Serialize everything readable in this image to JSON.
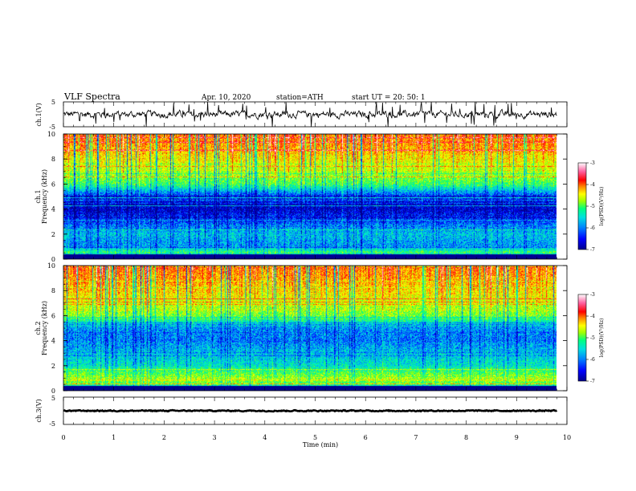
{
  "header": {
    "title": "VLF  Spectra",
    "date": "Apr. 10, 2020",
    "station": "station=ATH",
    "start": "start  UT  =    20: 50: 1"
  },
  "colors": {
    "background": "#ffffff",
    "axes": "#000000",
    "waveform": "#000000",
    "colormap": [
      "#00008b",
      "#0000ff",
      "#0080ff",
      "#00e0e0",
      "#00ff80",
      "#a0ff00",
      "#ffff00",
      "#ff8000",
      "#ff0000",
      "#ff60a0",
      "#ffffff"
    ]
  },
  "chart_data": [
    {
      "type": "line",
      "panel": "ch1-waveform",
      "ylabel": "ch.1(V)",
      "ylim": [
        -5,
        5
      ],
      "y_tick_labels": [
        "5",
        "-5"
      ],
      "x_range_min": [
        0,
        9.8
      ],
      "trace_level_v": 0,
      "trace_spread_v": 2
    },
    {
      "type": "heatmap",
      "panel": "ch1-spectrogram",
      "title": "ch.1",
      "ylabel": "Frequency  (kHz)",
      "ylim": [
        0,
        10
      ],
      "y_tick_labels": [
        "0",
        "2",
        "4",
        "6",
        "8",
        "10"
      ],
      "x_range_min": [
        0,
        9.8
      ],
      "colorbar": {
        "label": "log(PSD)(V²/Hz)",
        "range": [
          -7,
          -3
        ],
        "tick_labels": [
          "-7",
          "-6",
          "-5",
          "-4",
          "-3"
        ]
      },
      "freq_profile_logpsd": [
        {
          "f": 0.0,
          "v": -7.0
        },
        {
          "f": 0.5,
          "v": -5.3
        },
        {
          "f": 1.0,
          "v": -6.1
        },
        {
          "f": 2.0,
          "v": -5.9
        },
        {
          "f": 3.0,
          "v": -6.4
        },
        {
          "f": 4.0,
          "v": -6.8
        },
        {
          "f": 5.0,
          "v": -6.5
        },
        {
          "f": 6.0,
          "v": -5.3
        },
        {
          "f": 7.0,
          "v": -4.9
        },
        {
          "f": 8.0,
          "v": -4.6
        },
        {
          "f": 9.0,
          "v": -4.3
        },
        {
          "f": 10.0,
          "v": -4.1
        }
      ]
    },
    {
      "type": "heatmap",
      "panel": "ch2-spectrogram",
      "title": "ch.2",
      "ylabel": "Frequency  (kHz)",
      "ylim": [
        0,
        10
      ],
      "y_tick_labels": [
        "0",
        "2",
        "4",
        "6",
        "8",
        "10"
      ],
      "x_range_min": [
        0,
        9.8
      ],
      "colorbar": {
        "label": "log(PSD)(V²/Hz)",
        "range": [
          -7,
          -3
        ],
        "tick_labels": [
          "-7",
          "-6",
          "-5",
          "-4",
          "-3"
        ]
      },
      "freq_profile_logpsd": [
        {
          "f": 0.0,
          "v": -7.0
        },
        {
          "f": 0.5,
          "v": -5.2
        },
        {
          "f": 1.0,
          "v": -4.9
        },
        {
          "f": 2.0,
          "v": -5.7
        },
        {
          "f": 3.0,
          "v": -5.9
        },
        {
          "f": 4.0,
          "v": -6.2
        },
        {
          "f": 5.0,
          "v": -6.1
        },
        {
          "f": 6.0,
          "v": -5.1
        },
        {
          "f": 7.0,
          "v": -4.8
        },
        {
          "f": 8.0,
          "v": -4.5
        },
        {
          "f": 9.0,
          "v": -4.3
        },
        {
          "f": 10.0,
          "v": -4.1
        }
      ]
    },
    {
      "type": "line",
      "panel": "ch3-waveform",
      "ylabel": "ch.3(V)",
      "ylim": [
        -5,
        5
      ],
      "y_tick_labels": [
        "5",
        "-5"
      ],
      "x_range_min": [
        0,
        9.8
      ],
      "trace_level_v": 0,
      "trace_spread_v": 0.3
    }
  ],
  "x_axis": {
    "label": "Time  (min)",
    "range": [
      0,
      10
    ],
    "tick_labels": [
      "0",
      "1",
      "2",
      "3",
      "4",
      "5",
      "6",
      "7",
      "8",
      "9",
      "10"
    ]
  }
}
